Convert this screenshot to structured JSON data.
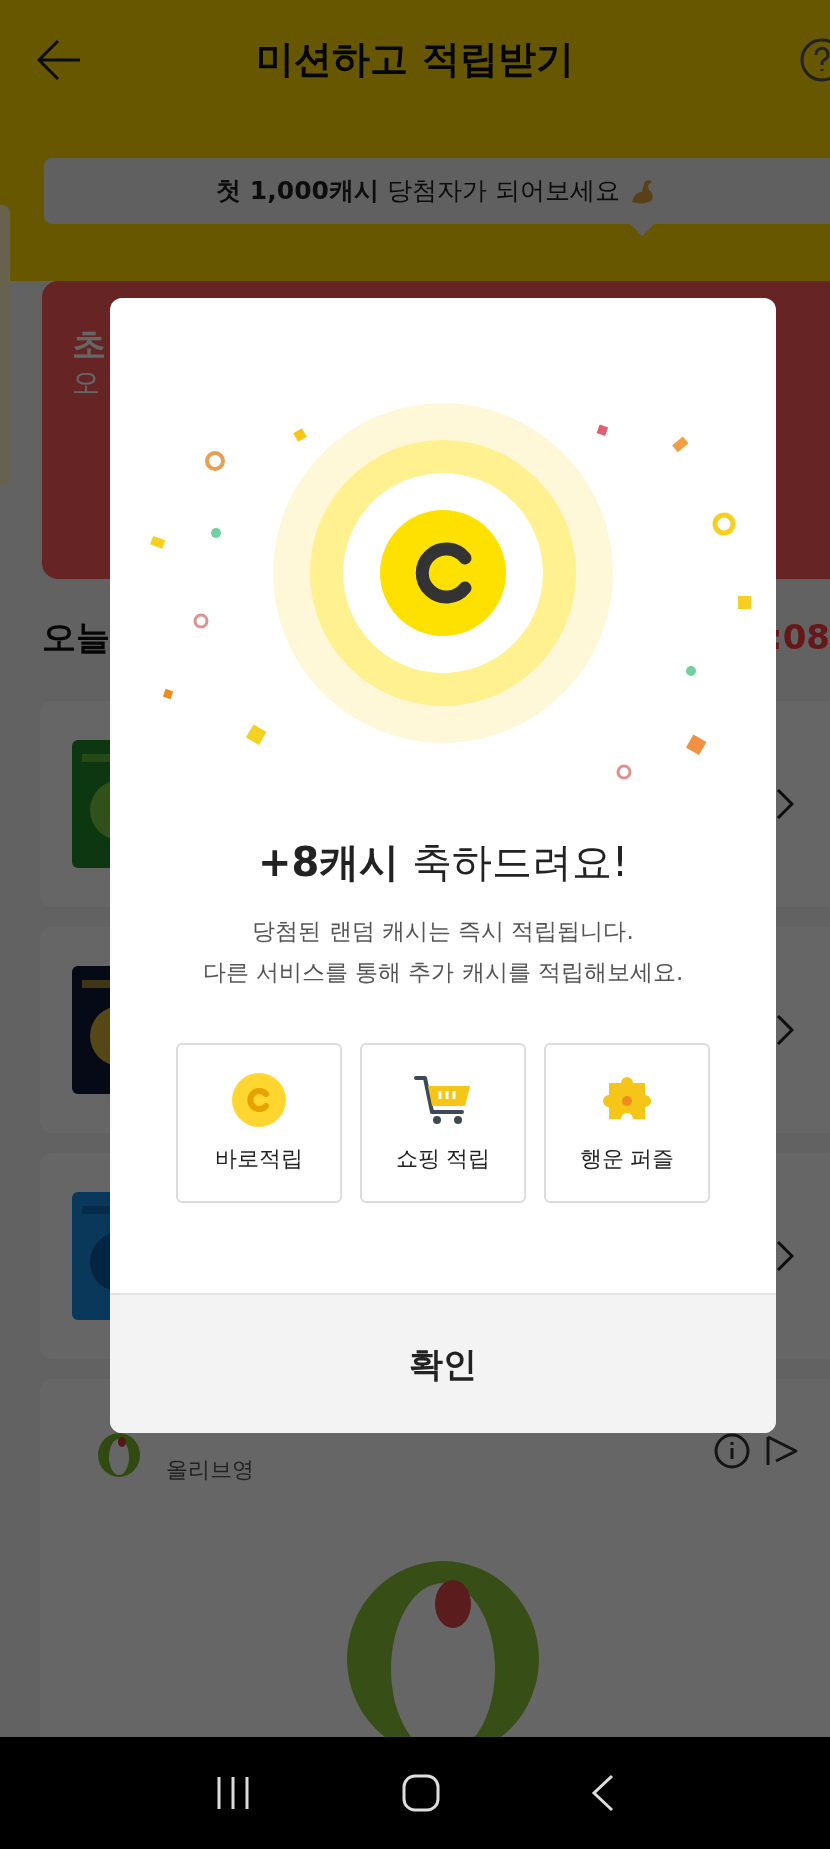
{
  "header": {
    "title": "미션하고 적립받기"
  },
  "banner": {
    "text": "**첫 1,000캐시** 당첨자가 되어보세요"
  },
  "promo_card": {
    "title": "초",
    "subtitle": "오"
  },
  "section": {
    "title": "오늘",
    "timer": ":08"
  },
  "ad_card": {
    "brand": "올리브영"
  },
  "dialog": {
    "title": "**+8캐시** 축하드려요!",
    "description": [
      "당첨된 랜덤 캐시는 즉시 적립됩니다.",
      "다른 서비스를 통해 추가 캐시를 적립해보세요."
    ],
    "options": [
      {
        "kind": "coin",
        "label": "바로적립"
      },
      {
        "kind": "cart",
        "label": "쇼핑 적립"
      },
      {
        "kind": "puzzle",
        "label": "행운 퍼즐"
      }
    ],
    "confirm": "확인"
  }
}
